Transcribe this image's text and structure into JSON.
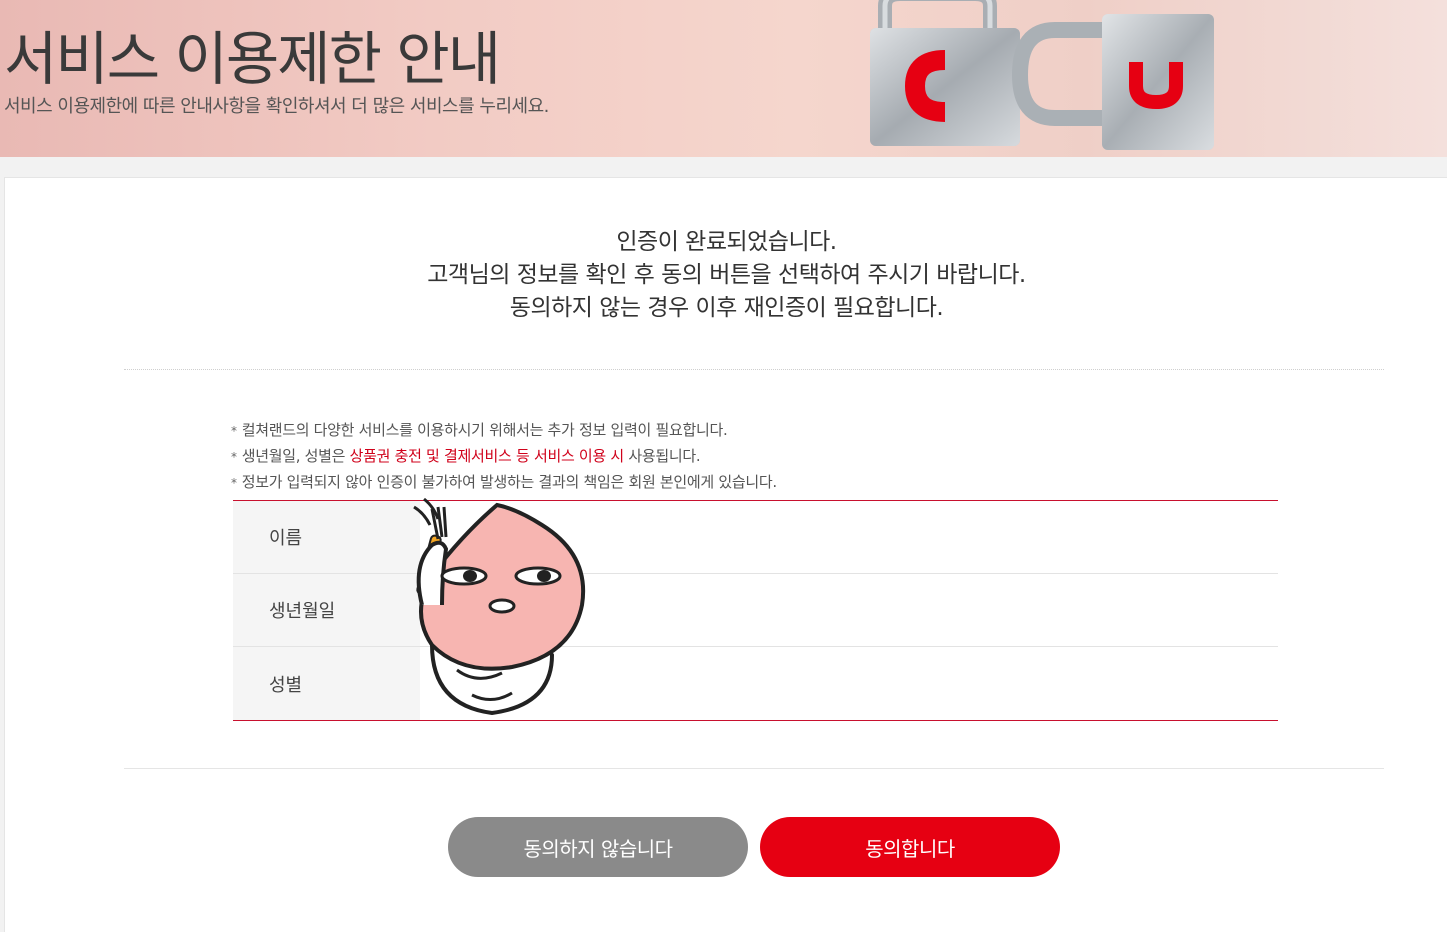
{
  "banner": {
    "title": "서비스 이용제한 안내",
    "subtitle": "서비스 이용제한에 따른 안내사항을 확인하셔서 더 많은 서비스를 누리세요."
  },
  "intro": {
    "line1": "인증이 완료되었습니다.",
    "line2": "고객님의 정보를 확인 후 동의 버튼을 선택하여 주시기 바랍니다.",
    "line3": "동의하지 않는 경우 이후 재인증이 필요합니다."
  },
  "notes": {
    "mark": "*",
    "note1": "컬쳐랜드의 다양한 서비스를 이용하시기 위해서는 추가 정보 입력이 필요합니다.",
    "note2_pre": "생년월일, 성별은 ",
    "note2_highlight": "상품권 충전 및 결제서비스 등 서비스 이용 시",
    "note2_post": " 사용됩니다.",
    "note3": "정보가 입력되지 않아 인증이 불가하여 발생하는 결과의 책임은 회원 본인에게 있습니다."
  },
  "table": {
    "rows": [
      {
        "label": "이름",
        "value": ""
      },
      {
        "label": "생년월일",
        "value": ""
      },
      {
        "label": "성별",
        "value": ""
      }
    ]
  },
  "buttons": {
    "disagree": "동의하지 않습니다",
    "agree": "동의합니다"
  },
  "colors": {
    "accent": "#e60012",
    "disagree_bg": "#8a8a8a",
    "table_border": "#c8102e",
    "highlight_text": "#d0021b"
  },
  "icons": {
    "banner_art": "padlock-cu-icon",
    "mascot": "peach-mascot-icon"
  }
}
